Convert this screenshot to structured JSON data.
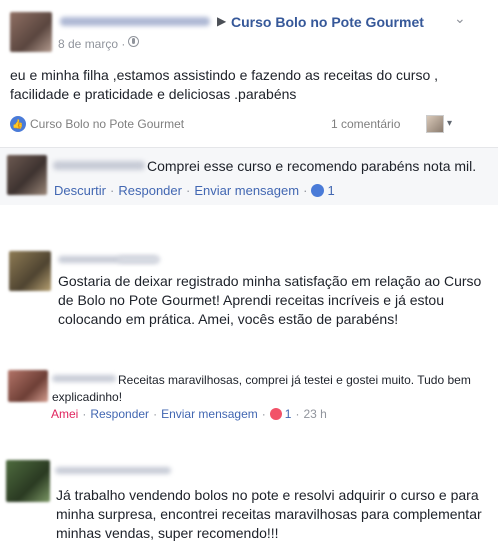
{
  "post": {
    "arrow": "▶",
    "page_name": "Curso Bolo no Pote Gourmet",
    "date": "8 de março ·",
    "chevron": "⌄",
    "body": [
      "eu e minha filha ,estamos assistindo e fazendo as receitas do curso ,",
      "facilidade e praticidade e deliciosas .parabéns"
    ],
    "likers": "Curso Bolo no Pote Gourmet",
    "comments_count": "1 comentário",
    "share_caret": "▾"
  },
  "comments": [
    {
      "text": "Comprei esse curso e recomendo parabéns nota mil.",
      "actions": {
        "unlike": "Descurtir",
        "reply": "Responder",
        "message": "Enviar mensagem",
        "reaction_count": "1"
      }
    },
    {
      "lines": [
        "Gostaria de deixar registrado minha satisfação em relação ao Curso",
        "de Bolo no Pote Gourmet! Aprendi receitas incríveis e já estou",
        "colocando em prática. Amei, vocês estão de parabéns!"
      ]
    },
    {
      "lines": [
        "Receitas maravilhosas, comprei já testei e gostei muito. Tudo bem",
        "explicadinho!"
      ],
      "actions": {
        "love": "Amei",
        "reply": "Responder",
        "message": "Enviar mensagem",
        "reaction_count": "1",
        "time": "23 h"
      }
    },
    {
      "lines": [
        "Já trabalho vendendo bolos no pote e resolvi adquirir o curso e para",
        "minha surpresa, encontrei receitas maravilhosas para complementar",
        "minhas vendas, super recomendo!!!"
      ]
    }
  ],
  "colors": {
    "link": "#4267b2",
    "page_name": "#365899",
    "love": "#e0245e",
    "muted": "#90949c"
  }
}
